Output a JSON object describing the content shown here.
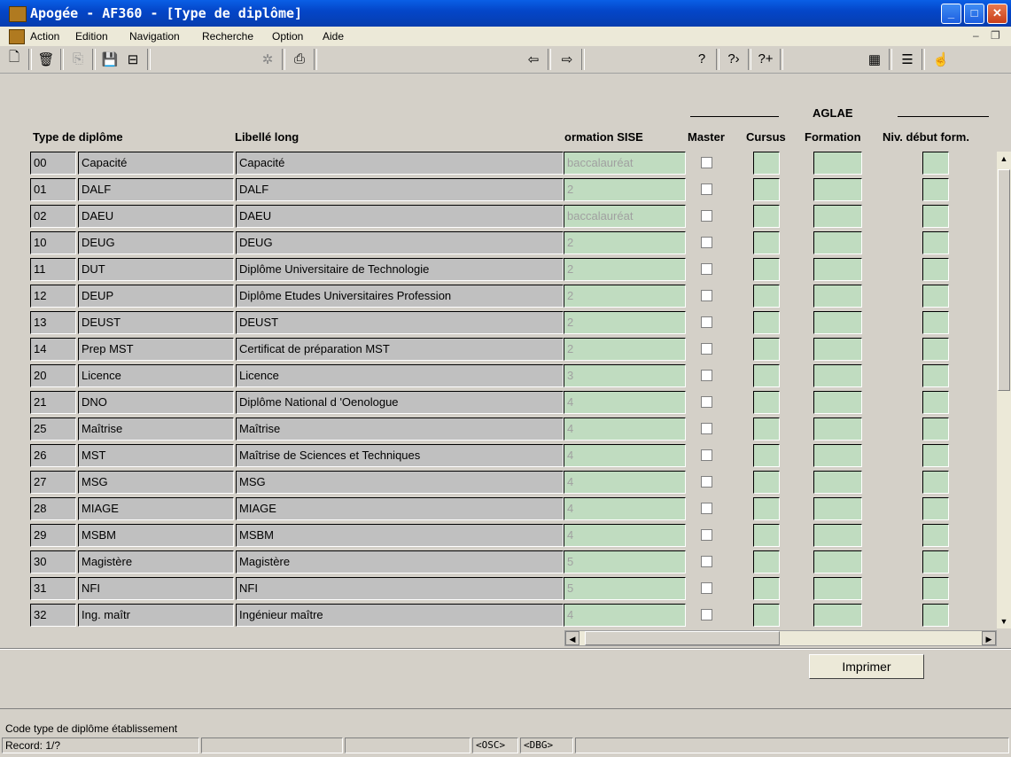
{
  "window": {
    "title": "Apogée - AF360 - [Type de diplôme]"
  },
  "menu": [
    "Action",
    "Edition",
    "Navigation",
    "Recherche",
    "Option",
    "Aide"
  ],
  "columns": {
    "type": "Type de diplôme",
    "libelle_long": "Libellé long",
    "sise": "ormation SISE",
    "master": "Master",
    "aglae_group": "AGLAE",
    "cursus": "Cursus",
    "formation": "Formation",
    "niv": "Niv. début form."
  },
  "rows": [
    {
      "code": "00",
      "libelle": "Capacité",
      "libelle_long": "Capacité",
      "sise": "baccalauréat"
    },
    {
      "code": "01",
      "libelle": "DALF",
      "libelle_long": "DALF",
      "sise": "2"
    },
    {
      "code": "02",
      "libelle": "DAEU",
      "libelle_long": "DAEU",
      "sise": "baccalauréat"
    },
    {
      "code": "10",
      "libelle": "DEUG",
      "libelle_long": "DEUG",
      "sise": "2"
    },
    {
      "code": "11",
      "libelle": "DUT",
      "libelle_long": "Diplôme Universitaire de Technologie",
      "sise": "2"
    },
    {
      "code": "12",
      "libelle": "DEUP",
      "libelle_long": "Diplôme Etudes Universitaires Profession",
      "sise": "2"
    },
    {
      "code": "13",
      "libelle": "DEUST",
      "libelle_long": "DEUST",
      "sise": "2"
    },
    {
      "code": "14",
      "libelle": "Prep MST",
      "libelle_long": "Certificat de préparation MST",
      "sise": "2"
    },
    {
      "code": "20",
      "libelle": "Licence",
      "libelle_long": "Licence",
      "sise": "3"
    },
    {
      "code": "21",
      "libelle": "DNO",
      "libelle_long": "Diplôme National d 'Oenologue",
      "sise": "4"
    },
    {
      "code": "25",
      "libelle": "Maîtrise",
      "libelle_long": "Maîtrise",
      "sise": "4"
    },
    {
      "code": "26",
      "libelle": "MST",
      "libelle_long": "Maîtrise de Sciences et Techniques",
      "sise": "4"
    },
    {
      "code": "27",
      "libelle": "MSG",
      "libelle_long": "MSG",
      "sise": "4"
    },
    {
      "code": "28",
      "libelle": "MIAGE",
      "libelle_long": "MIAGE",
      "sise": "4"
    },
    {
      "code": "29",
      "libelle": "MSBM",
      "libelle_long": "MSBM",
      "sise": "4"
    },
    {
      "code": "30",
      "libelle": "Magistère",
      "libelle_long": "Magistère",
      "sise": "5"
    },
    {
      "code": "31",
      "libelle": "NFI",
      "libelle_long": "NFI",
      "sise": "5"
    },
    {
      "code": "32",
      "libelle": "Ing. maîtr",
      "libelle_long": "Ingénieur maître",
      "sise": "4"
    }
  ],
  "print_button": "Imprimer",
  "hint": "Code type de diplôme établissement",
  "status": {
    "record": "Record: 1/?",
    "osc": "<OSC>",
    "dbg": "<DBG>"
  }
}
